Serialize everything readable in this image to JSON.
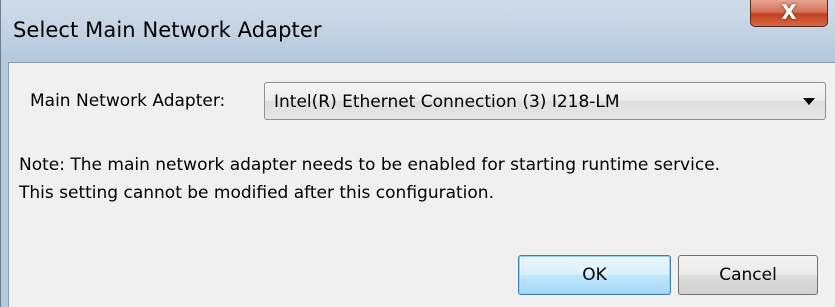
{
  "window": {
    "title": "Select Main Network Adapter",
    "close_glyph": "X"
  },
  "form": {
    "adapter_label": "Main Network Adapter:",
    "adapter_value": "Intel(R) Ethernet Connection (3) I218-LM"
  },
  "note": {
    "line1": "Note: The main network adapter needs to be enabled for starting runtime service.",
    "line2": "This setting cannot be modified after this configuration."
  },
  "buttons": {
    "ok_label": "OK",
    "cancel_label": "Cancel"
  },
  "colors": {
    "title_bar": "#c4d3e4",
    "close_button": "#c2401f",
    "client_background": "#f0f0f0",
    "default_button_border": "#3c7fb1"
  }
}
